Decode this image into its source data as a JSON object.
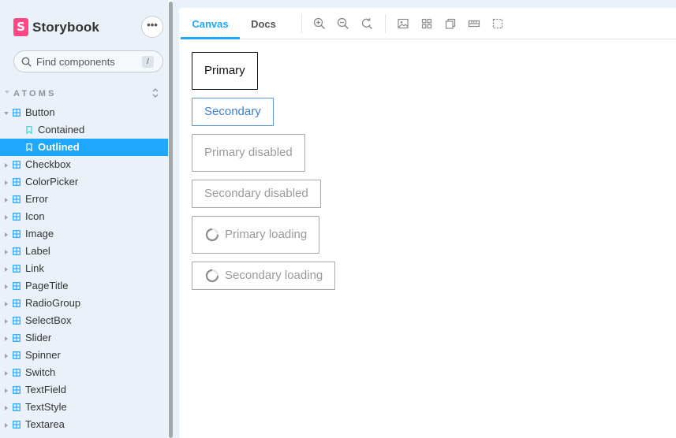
{
  "sidebar": {
    "brand": "Storybook",
    "brand_letter": "S",
    "menu_label": "•••",
    "search": {
      "placeholder": "Find components",
      "shortcut": "/"
    },
    "section": "ATOMS",
    "items": [
      {
        "label": "Button",
        "type": "component",
        "expanded": true
      },
      {
        "label": "Contained",
        "type": "story"
      },
      {
        "label": "Outlined",
        "type": "story",
        "active": true
      },
      {
        "label": "Checkbox",
        "type": "component"
      },
      {
        "label": "ColorPicker",
        "type": "component"
      },
      {
        "label": "Error",
        "type": "component"
      },
      {
        "label": "Icon",
        "type": "component"
      },
      {
        "label": "Image",
        "type": "component"
      },
      {
        "label": "Label",
        "type": "component"
      },
      {
        "label": "Link",
        "type": "component"
      },
      {
        "label": "PageTitle",
        "type": "component"
      },
      {
        "label": "RadioGroup",
        "type": "component"
      },
      {
        "label": "SelectBox",
        "type": "component"
      },
      {
        "label": "Slider",
        "type": "component"
      },
      {
        "label": "Spinner",
        "type": "component"
      },
      {
        "label": "Switch",
        "type": "component"
      },
      {
        "label": "TextField",
        "type": "component"
      },
      {
        "label": "TextStyle",
        "type": "component"
      },
      {
        "label": "Textarea",
        "type": "component"
      }
    ]
  },
  "toolbar": {
    "tabs": [
      {
        "label": "Canvas",
        "active": true
      },
      {
        "label": "Docs",
        "active": false
      }
    ],
    "tools": [
      "zoom-in-icon",
      "zoom-out-icon",
      "zoom-reset-icon",
      "background-icon",
      "grid-icon",
      "viewport-icon",
      "measure-icon",
      "outline-icon"
    ]
  },
  "canvas": {
    "buttons": [
      {
        "label": "Primary",
        "variant": "primary"
      },
      {
        "label": "Secondary",
        "variant": "secondary"
      },
      {
        "label": "Primary disabled",
        "variant": "primary-disabled"
      },
      {
        "label": "Secondary disabled",
        "variant": "secondary-disabled"
      },
      {
        "label": "Primary loading",
        "variant": "primary-loading"
      },
      {
        "label": "Secondary loading",
        "variant": "secondary-loading"
      }
    ]
  },
  "colors": {
    "accent": "#1ea7fd",
    "brand": "#ff4785",
    "sidebar_bg": "#eaf1f8",
    "secondary_button": "#3f7ed0"
  }
}
